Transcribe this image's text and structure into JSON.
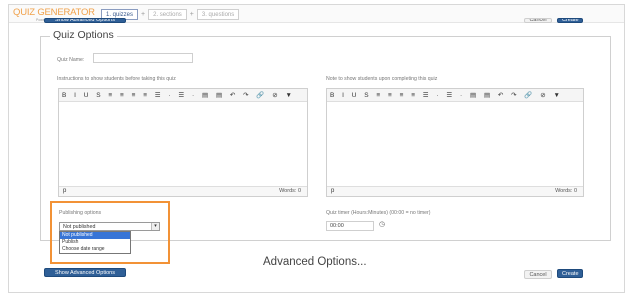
{
  "app": {
    "logo": "QUIZ GENERATOR",
    "logo_sub": "Powered by FMAX"
  },
  "steps": [
    {
      "label": "1. quizzes",
      "active": true
    },
    {
      "label": "2. sections",
      "active": false
    },
    {
      "label": "3. questions",
      "active": false
    }
  ],
  "step_separator": "+",
  "top_actions": {
    "show_advanced": "Show Advanced Options",
    "cancel": "Cancel",
    "create": "Create"
  },
  "quiz_options": {
    "legend": "Quiz Options",
    "quiz_name_label": "Quiz Name:",
    "quiz_name_value": "",
    "instructions_label": "Instructions to show students before taking this quiz",
    "note_label": "Note to show students upon completing this quiz",
    "toolbar_glyphs": "B I U S ≡ ≡ ≡ ≡ ☰ · ☰ · ▤ ▤ ↶ ↷ 🔗 ⊘ ▼",
    "path_label": "p",
    "words_label": "Words: 0",
    "publishing_label": "Publishing options",
    "publishing_selected": "Not published",
    "publishing_options": [
      "Not published",
      "Publish",
      "Choose date range"
    ],
    "timer_label": "Quiz timer (Hours:Minutes) (00:00 = no timer)",
    "timer_value": "00:00",
    "timer_icon": "clock-icon"
  },
  "advanced_title": "Advanced Options...",
  "bottom_actions": {
    "show_advanced": "Show Advanced Options",
    "cancel": "Cancel",
    "create": "Create"
  },
  "colors": {
    "accent_blue": "#2f5f97",
    "highlight_orange": "#f29236",
    "logo_orange": "#f0a14a",
    "selection_blue": "#3875d7"
  }
}
